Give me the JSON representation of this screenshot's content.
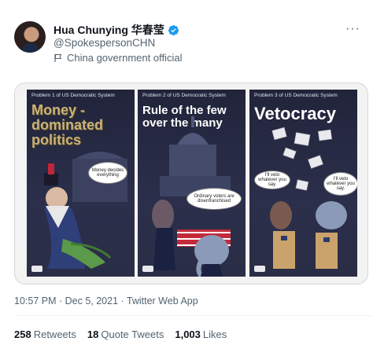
{
  "author": {
    "name": "Hua Chunying 华春莹",
    "handle": "@SpokespersonCHN",
    "label": "China government official"
  },
  "media": {
    "panels": [
      {
        "tag": "Problem 1 of US Democratic System",
        "title": "Money -dominated politics",
        "bubble": "Money decides everything"
      },
      {
        "tag": "Problem 2 of US Democratic System",
        "title": "Rule of the few over the many",
        "bubble": "Ordinary voters are disenfranchised"
      },
      {
        "tag": "Problem 3 of US Democratic System",
        "title": "Vetocracy",
        "bubble_left": "I'll veto whatever you say.",
        "bubble_right": "I'll veto whatever you say."
      }
    ],
    "logo_text": "News"
  },
  "timestamp": "10:57 PM · Dec 5, 2021 · Twitter Web App",
  "stats": {
    "retweets": {
      "count": "258",
      "label": "Retweets"
    },
    "quotes": {
      "count": "18",
      "label": "Quote Tweets"
    },
    "likes": {
      "count": "1,003",
      "label": "Likes"
    }
  },
  "colors": {
    "verified": "#1d9bf0",
    "muted": "#536471",
    "border": "#cfd9de"
  },
  "icons": {
    "verified": "verified-badge-icon",
    "label": "flag-icon",
    "more": "more-icon"
  }
}
